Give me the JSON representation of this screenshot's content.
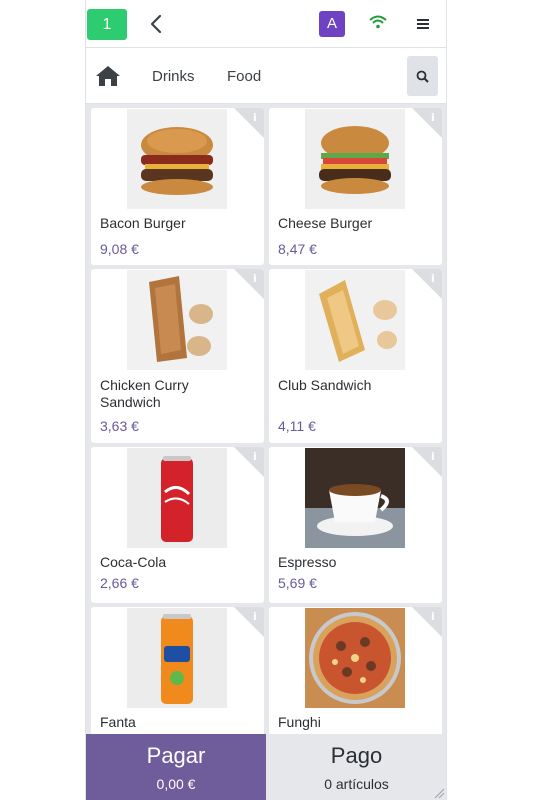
{
  "header": {
    "order_number": "1",
    "avatar_letter": "A",
    "icons": [
      "back-icon",
      "wifi-icon",
      "hamburger-menu-icon"
    ]
  },
  "categories": {
    "home_icon": "home-icon",
    "items": [
      "Drinks",
      "Food"
    ],
    "search_icon": "search-icon"
  },
  "products": [
    {
      "name": "Bacon Burger",
      "price": "9,08 €",
      "image": "bacon-burger"
    },
    {
      "name": "Cheese Burger",
      "price": "8,47 €",
      "image": "cheese-burger"
    },
    {
      "name": "Chicken Curry Sandwich",
      "price": "3,63 €",
      "image": "chicken-curry-sandwich"
    },
    {
      "name": "Club Sandwich",
      "price": "4,11 €",
      "image": "club-sandwich"
    },
    {
      "name": "Coca-Cola",
      "price": "2,66 €",
      "image": "coca-cola-can"
    },
    {
      "name": "Espresso",
      "price": "5,69 €",
      "image": "espresso-cup"
    },
    {
      "name": "Fanta",
      "price": "",
      "image": "fanta-can"
    },
    {
      "name": "Funghi",
      "price": "",
      "image": "funghi-pizza"
    }
  ],
  "footer": {
    "pay_label": "Pagar",
    "pay_amount": "0,00 €",
    "order_label": "Pago",
    "order_count": "0 artículos"
  },
  "colors": {
    "accent": "#6f5c9a",
    "badge_green": "#2ecc71",
    "avatar_purple": "#6f42c1",
    "wifi_green": "#1e9e3a"
  }
}
